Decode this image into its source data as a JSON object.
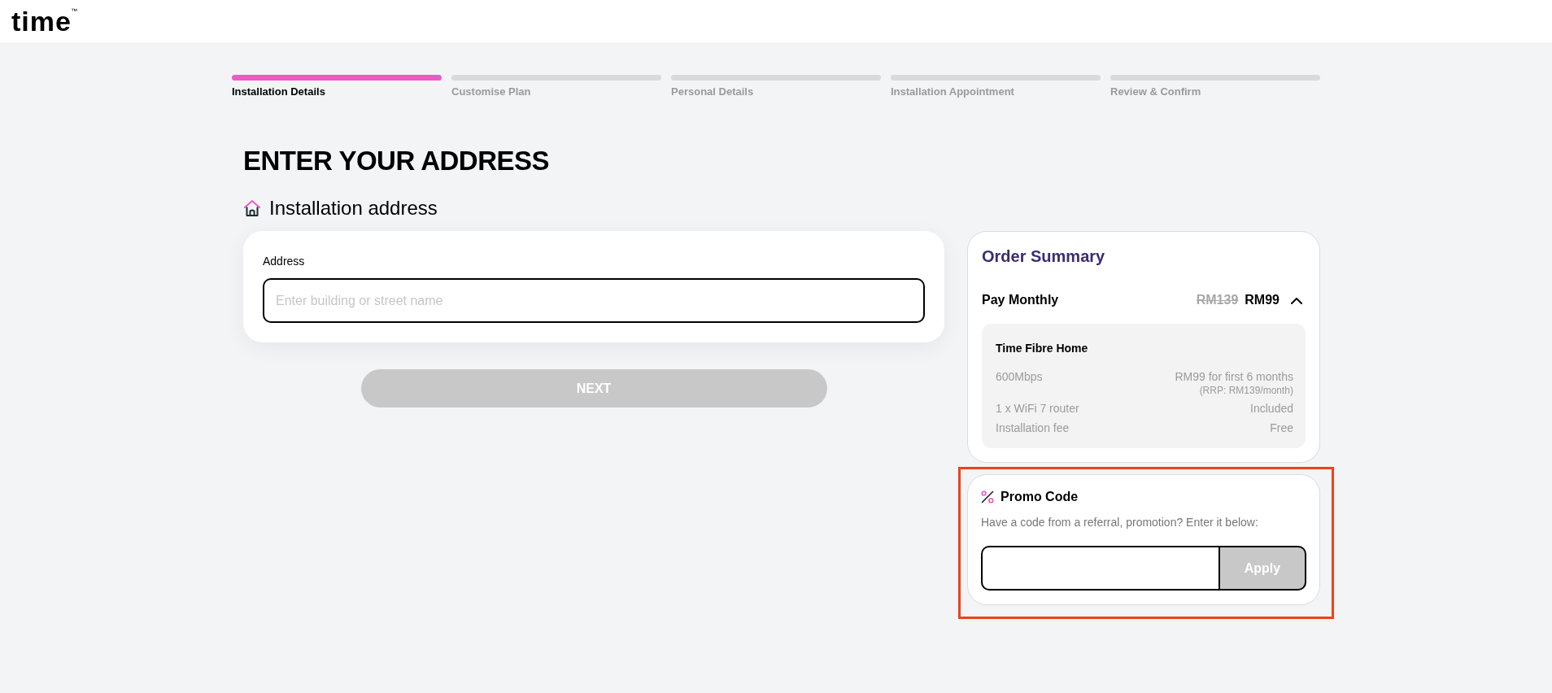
{
  "header": {
    "logo": "time",
    "logo_mark": "™"
  },
  "steps": [
    {
      "label": "Installation Details",
      "selected": true
    },
    {
      "label": "Customise Plan",
      "selected": false
    },
    {
      "label": "Personal Details",
      "selected": false
    },
    {
      "label": "Installation Appointment",
      "selected": false
    },
    {
      "label": "Review & Confirm",
      "selected": false
    }
  ],
  "page_title": "ENTER YOUR ADDRESS",
  "section_title": "Installation address",
  "address_form": {
    "label": "Address",
    "placeholder": "Enter building or street name"
  },
  "next_button": {
    "label": "NEXT",
    "disabled": true
  },
  "order_summary": {
    "title": "Order Summary",
    "plan_row": {
      "label": "Pay Monthly",
      "old_price": "RM139",
      "price": "RM99",
      "expanded": true
    },
    "details": {
      "title": "Time Fibre Home",
      "rows": [
        {
          "label": "600Mbps",
          "value": "RM99 for first 6 months",
          "note": "(RRP: RM139/month)"
        },
        {
          "label": "1 x WiFi 7 router",
          "value": "Included"
        },
        {
          "label": "Installation fee",
          "value": "Free"
        }
      ]
    }
  },
  "promo": {
    "title": "Promo Code",
    "description": "Have a code from a referral, promotion? Enter it below:",
    "button": "Apply",
    "button_disabled": true,
    "highlighted": true
  }
}
